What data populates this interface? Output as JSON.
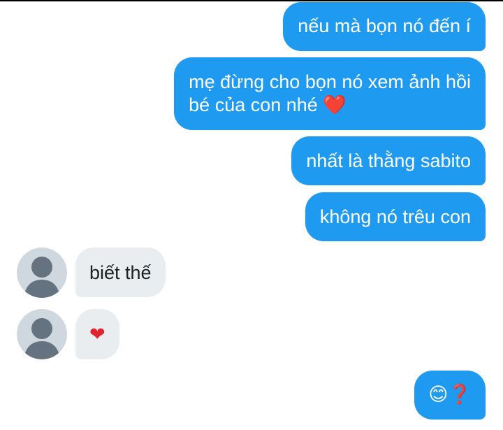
{
  "conversation": {
    "messages": [
      {
        "from": "me",
        "text": "nếu mà bọn nó đến í"
      },
      {
        "from": "me",
        "lines": [
          "mẹ đừng cho bọn nó xem ảnh hồi",
          "bé của con nhé"
        ],
        "emoji": "❤️"
      },
      {
        "from": "me",
        "text": "nhất là thằng sabito"
      },
      {
        "from": "me",
        "text": "không nó trêu con"
      },
      {
        "from": "them",
        "text": "biết thế"
      },
      {
        "from": "them",
        "emoji": "❤"
      },
      {
        "from": "me",
        "emoji": "😊❓"
      }
    ]
  },
  "avatar": {
    "icon": "default-user-avatar-icon"
  },
  "colors": {
    "outgoing_bubble": "#1e9af0",
    "incoming_bubble": "#e9edf0",
    "avatar_bg": "#cfd8de",
    "avatar_fg": "#64737f"
  }
}
